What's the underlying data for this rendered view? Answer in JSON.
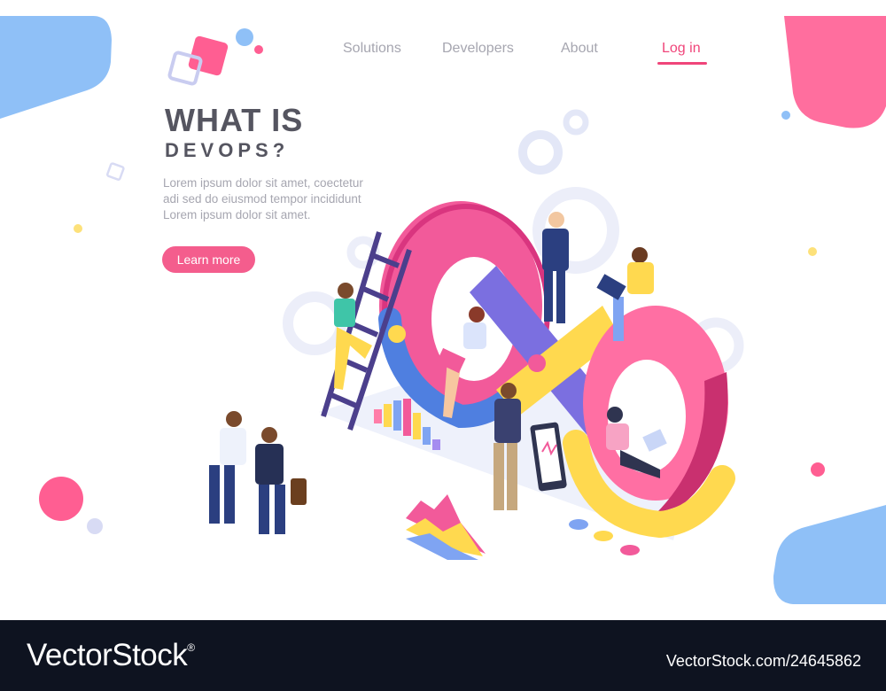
{
  "nav": {
    "items": [
      {
        "label": "Solutions"
      },
      {
        "label": "Developers"
      },
      {
        "label": "About"
      },
      {
        "label": "Log in"
      }
    ]
  },
  "hero": {
    "title_line1": "WHAT IS",
    "title_line2": "DEVOPS?",
    "body_lines": [
      "Lorem ipsum dolor sit amet, coectetur",
      "adi sed do eiusmod tempor incididunt",
      "Lorem ipsum dolor sit amet."
    ],
    "cta_label": "Learn more"
  },
  "watermark": {
    "logo_text": "VectorStock",
    "registered_mark": "®",
    "image_id": "VectorStock.com/24645862"
  },
  "colors": {
    "accent_pink": "#f0457a",
    "button_pink": "#f45d8d",
    "blob_blue": "#8fc0f7",
    "blob_pink": "#ff6e9e",
    "footer_bg": "#0e1320",
    "title_gray": "#555560",
    "text_gray": "#a6a6b0"
  },
  "illustration": {
    "subject": "isometric-devops-infinity-loop",
    "icons": [
      "gear-icon",
      "ladder-icon",
      "bar-chart-icon",
      "area-chart-icon",
      "tablet-icon",
      "laptop-icon",
      "briefcase-icon",
      "coin-icon"
    ]
  }
}
